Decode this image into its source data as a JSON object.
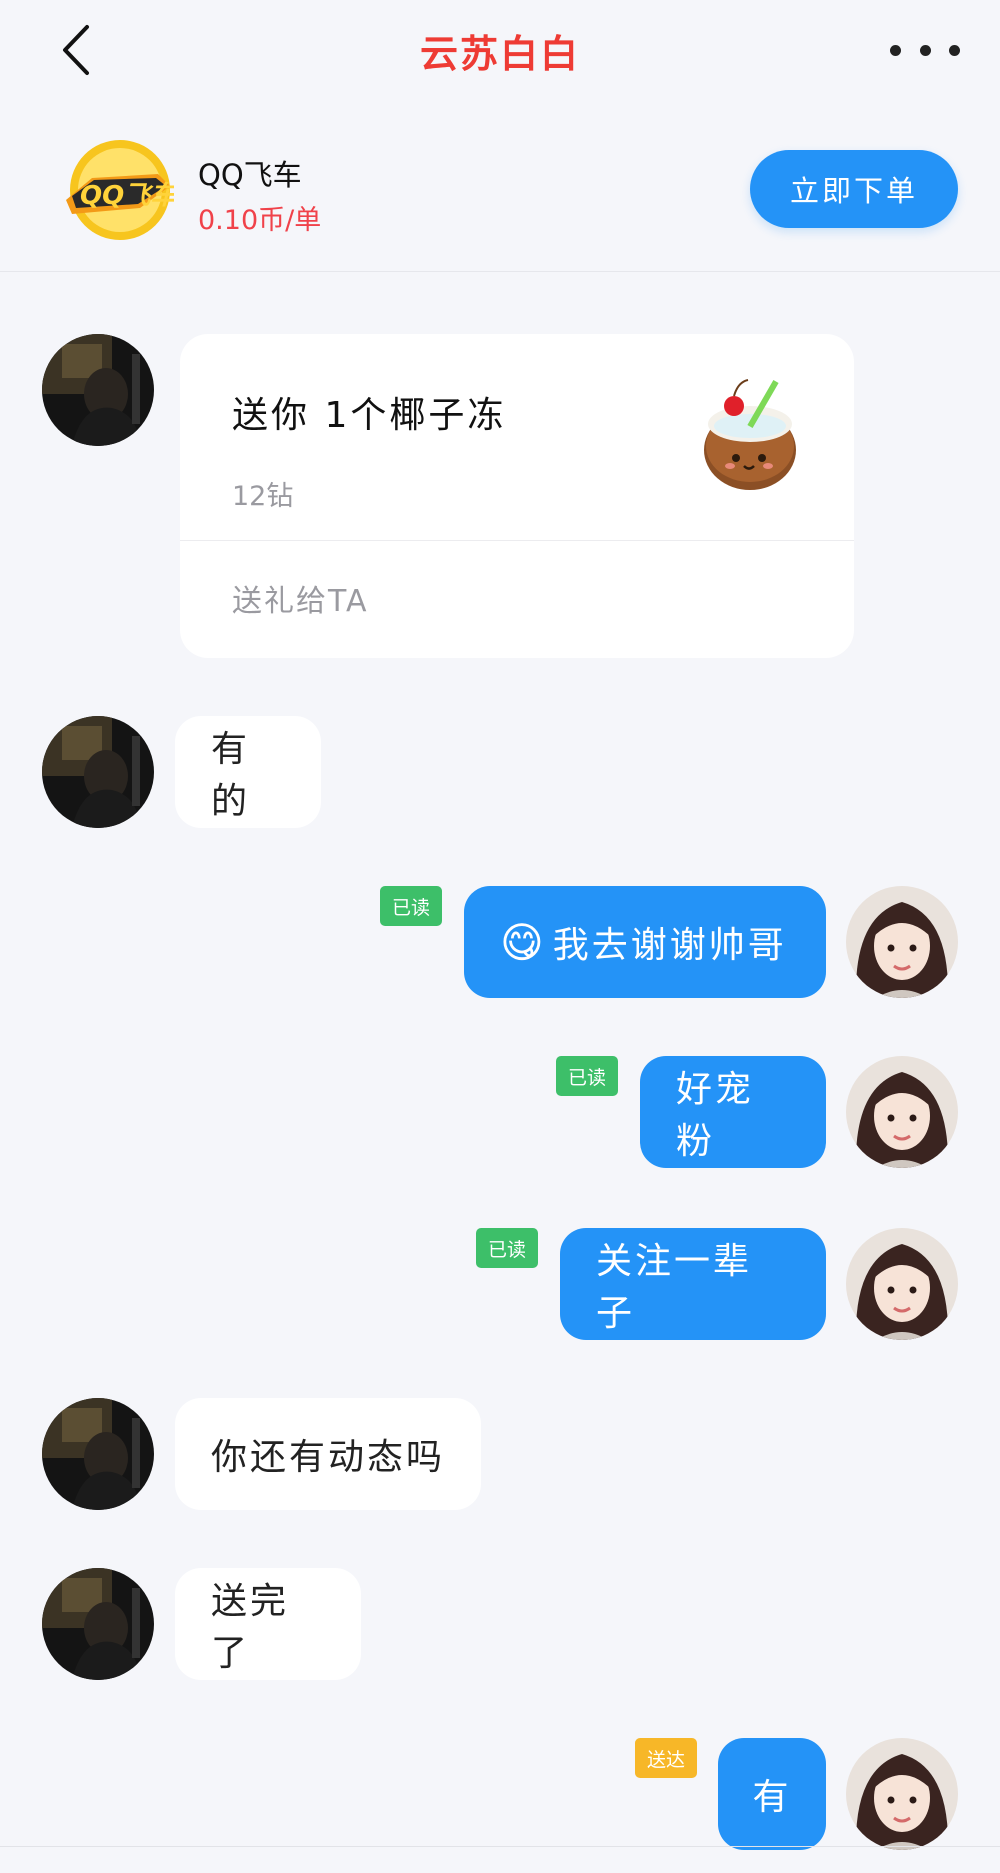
{
  "header": {
    "title": "云苏白白",
    "back_icon": "chevron-left-icon",
    "more_icon": "ellipsis-icon"
  },
  "product": {
    "name": "QQ飞车",
    "price": "0.10币/单",
    "order_label": "立即下单",
    "logo_icon": "qq-speed-logo-icon"
  },
  "gift": {
    "title": "送你 1个椰子冻",
    "price": "12钻",
    "action": "送礼给TA",
    "image_icon": "coconut-jelly-icon"
  },
  "messages": [
    {
      "side": "in",
      "text": "有的"
    },
    {
      "side": "out",
      "emoji": "😋",
      "text": "我去谢谢帅哥",
      "status": "已读"
    },
    {
      "side": "out",
      "text": "好宠粉",
      "status": "已读"
    },
    {
      "side": "out",
      "text": "关注一辈子",
      "status": "已读"
    },
    {
      "side": "in",
      "text": "你还有动态吗"
    },
    {
      "side": "in",
      "text": "送完了"
    },
    {
      "side": "out",
      "text": "有",
      "status": "送达"
    }
  ],
  "colors": {
    "accent_blue": "#2493f7",
    "title_red": "#ee3b34",
    "price_red": "#f0424a",
    "read_green": "#3dbf69",
    "delivered_yellow": "#f7b728",
    "background": "#f5f6fa"
  }
}
